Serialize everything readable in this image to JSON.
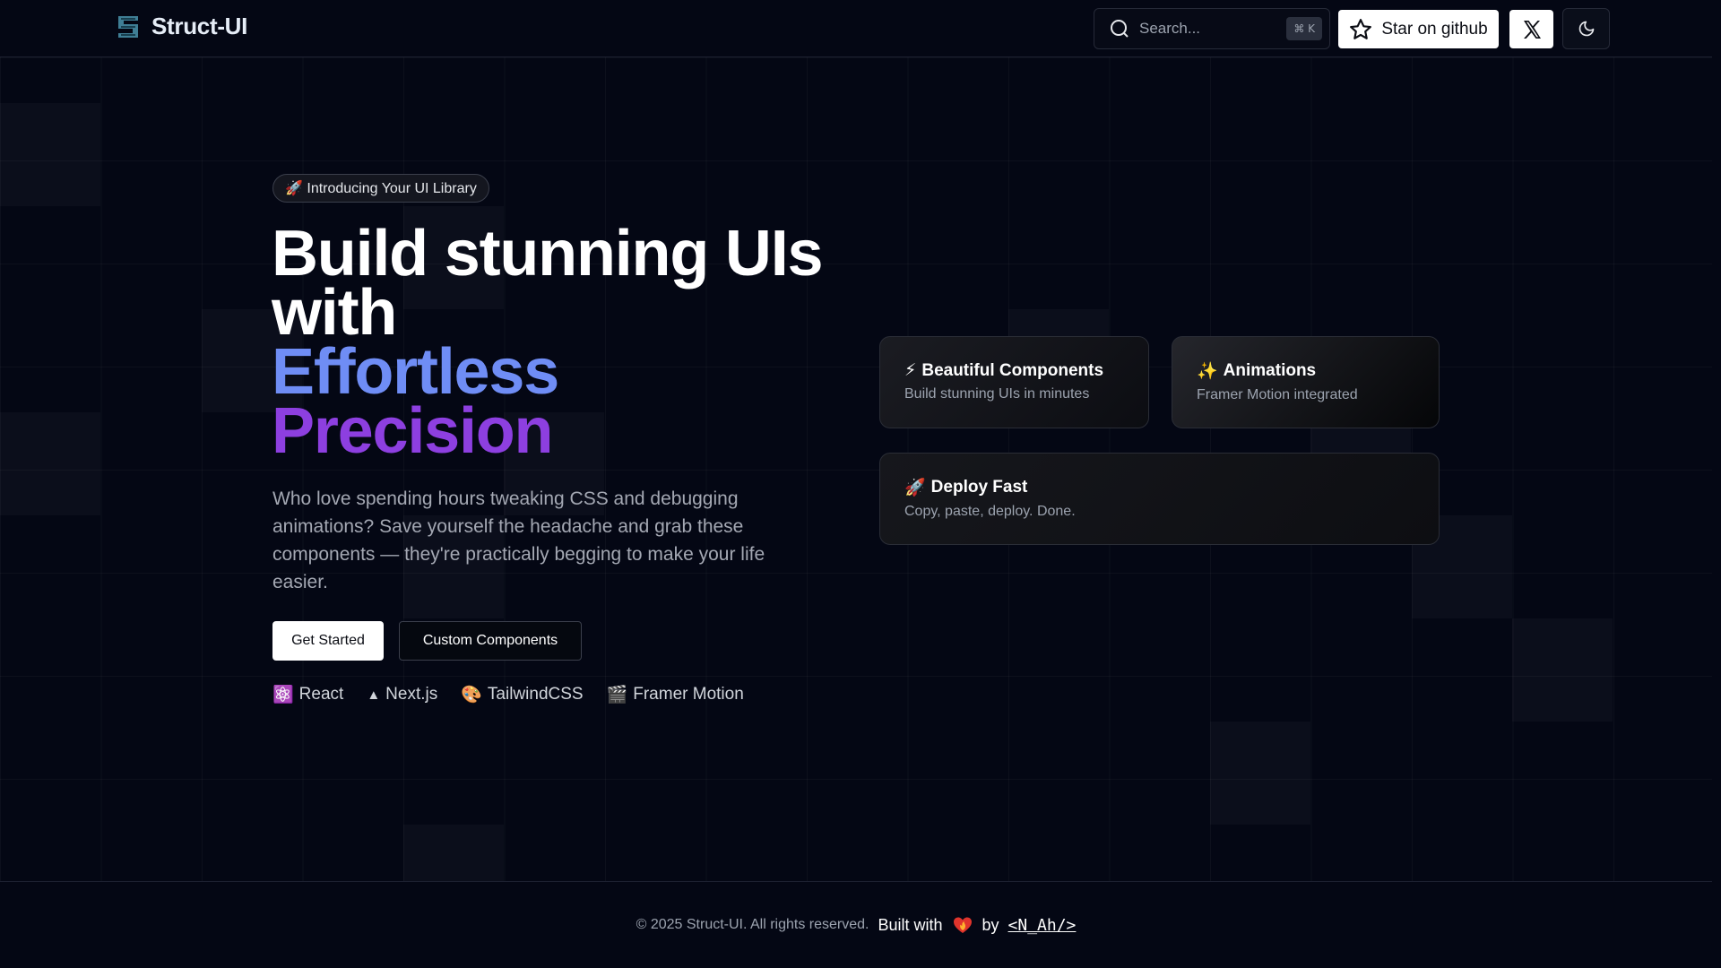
{
  "header": {
    "brand": "Struct-UI",
    "search_placeholder": "Search...",
    "search_shortcut": "⌘ K",
    "star_label": "Star on github"
  },
  "hero": {
    "badge": "🚀 Introducing Your UI Library",
    "headline_line1": "Build stunning UIs",
    "headline_line2": "with",
    "headline_line3": "Effortless",
    "headline_line4": "Precision",
    "lede": "Who love spending hours tweaking CSS and debugging animations? Save yourself the headache and grab these components — they're practically begging to make your life easier.",
    "primary_cta": "Get Started",
    "secondary_cta": "Custom Components",
    "tech": [
      {
        "icon": "⚛️",
        "label": "React"
      },
      {
        "icon": "▲",
        "label": "Next.js"
      },
      {
        "icon": "🎨",
        "label": "TailwindCSS"
      },
      {
        "icon": "🎬",
        "label": "Framer Motion"
      }
    ]
  },
  "features": [
    {
      "icon": "⚡",
      "title": "Beautiful Components",
      "desc": "Build stunning UIs in minutes"
    },
    {
      "icon": "✨",
      "title": "Animations",
      "desc": "Framer Motion integrated"
    },
    {
      "icon": "🚀",
      "title": "Deploy Fast",
      "desc": "Copy, paste, deploy. Done."
    }
  ],
  "footer": {
    "copyright": "© 2025 Struct-UI. All rights reserved.",
    "built_with": "Built with",
    "by": "by",
    "author": "<N_Ah/>"
  },
  "colors": {
    "background": "#040714",
    "accent_blue": "#6f8df5",
    "accent_purple": "#8d3fe0"
  }
}
